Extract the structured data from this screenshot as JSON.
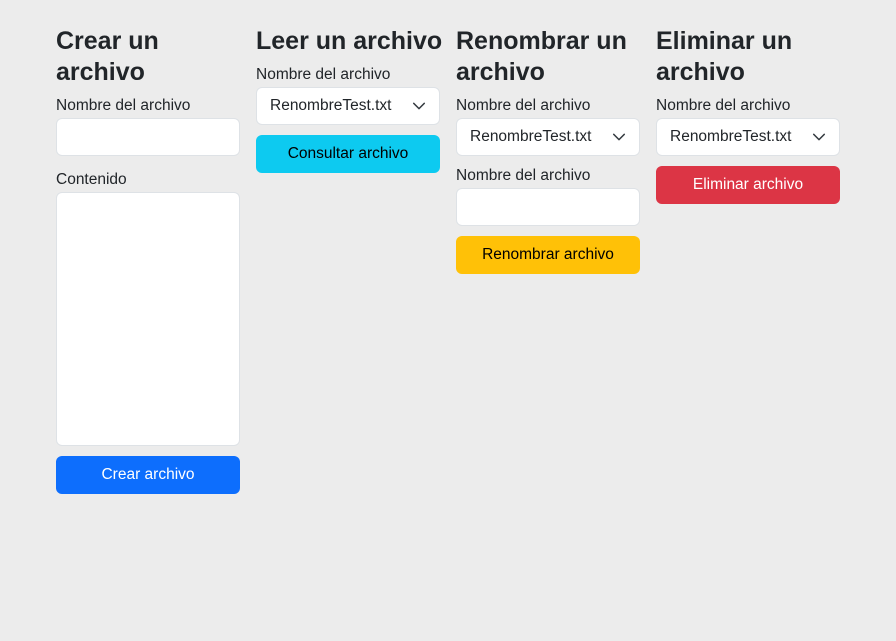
{
  "create": {
    "title": "Crear un archivo",
    "filename_label": "Nombre del archivo",
    "filename_value": "",
    "content_label": "Contenido",
    "content_value": "",
    "button_label": "Crear archivo",
    "button_color": "#0d6efd"
  },
  "read": {
    "title": "Leer un archivo",
    "filename_label": "Nombre del archivo",
    "selected_file": "RenombreTest.txt",
    "button_label": "Consultar archivo",
    "button_color": "#0dcaf0"
  },
  "rename": {
    "title": "Renombrar un archivo",
    "filename_label": "Nombre del archivo",
    "selected_file": "RenombreTest.txt",
    "new_name_label": "Nombre del archivo",
    "new_name_value": "",
    "button_label": "Renombrar archivo",
    "button_color": "#ffc107"
  },
  "delete": {
    "title": "Eliminar un archivo",
    "filename_label": "Nombre del archivo",
    "selected_file": "RenombreTest.txt",
    "button_label": "Eliminar archivo",
    "button_color": "#dc3545"
  },
  "icons": {
    "select_arrow": "chevron-down-icon"
  }
}
